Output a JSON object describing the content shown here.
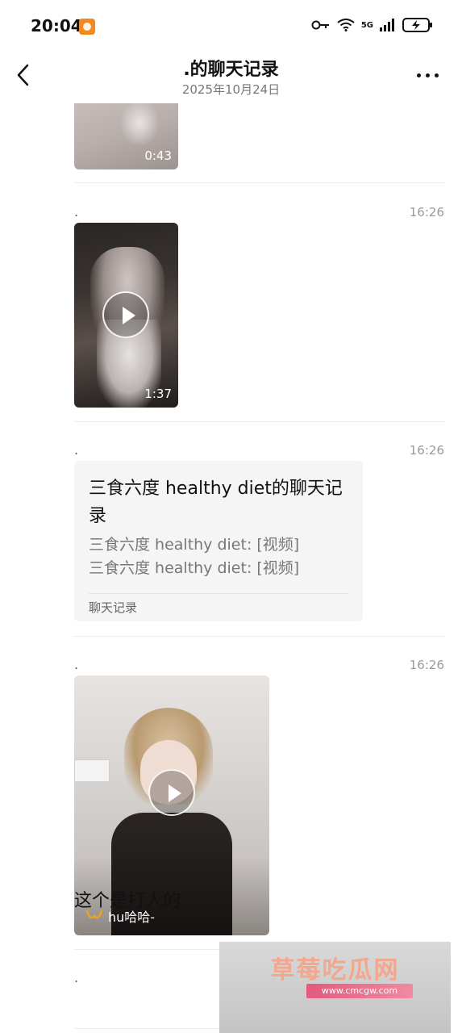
{
  "status_bar": {
    "time": "20:04",
    "network": "5G"
  },
  "header": {
    "title": ".的聊天记录",
    "subtitle": "2025年10月24日"
  },
  "messages": [
    {
      "type": "video",
      "duration": "0:43"
    },
    {
      "type": "video",
      "sender": ".",
      "time": "16:26",
      "duration": "1:37"
    },
    {
      "type": "chat_record",
      "sender": ".",
      "time": "16:26",
      "title": "三食六度 healthy diet的聊天记录",
      "lines": [
        "三食六度 healthy diet: [视频]",
        "三食六度 healthy diet: [视频]"
      ],
      "footer": "聊天记录"
    },
    {
      "type": "channel_video",
      "sender": ".",
      "time": "16:26",
      "channel_name": "hu哈哈-"
    },
    {
      "type": "text",
      "sender": ".",
      "text": "这个是打人的"
    }
  ],
  "watermark": {
    "title": "草莓吃瓜网",
    "url": "www.cmcgw.com"
  },
  "colors": {
    "card_bg": "#f5f5f5",
    "timestamp": "#9a9a9a",
    "watermark_accent": "#e35a7c"
  },
  "icons": [
    "back-arrow-icon",
    "more-icon",
    "play-icon",
    "channel-logo-icon",
    "key-icon",
    "wifi-icon",
    "signal-icon",
    "battery-icon"
  ]
}
